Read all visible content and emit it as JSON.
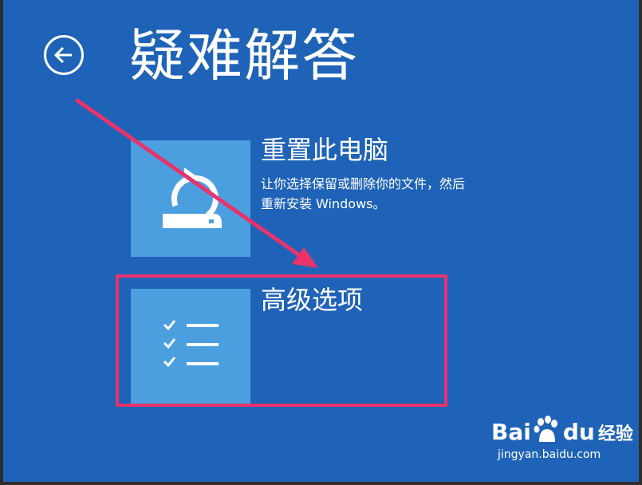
{
  "page": {
    "title": "疑难解答",
    "back_icon": "back-arrow-icon"
  },
  "options": [
    {
      "title": "重置此电脑",
      "description_line1": "让你选择保留或删除你的文件，然后",
      "description_line2": "重新安装 Windows。",
      "icon": "reset-pc-icon"
    },
    {
      "title": "高级选项",
      "icon": "checklist-icon"
    }
  ],
  "annotation": {
    "color": "#e8336b"
  },
  "watermark": {
    "brand_left": "Bai",
    "brand_mid": "du",
    "brand_right": "经验",
    "url": "jingyan.baidu.com"
  },
  "colors": {
    "background": "#1f63b8",
    "tile": "#4c9fdf",
    "text": "#ffffff"
  }
}
